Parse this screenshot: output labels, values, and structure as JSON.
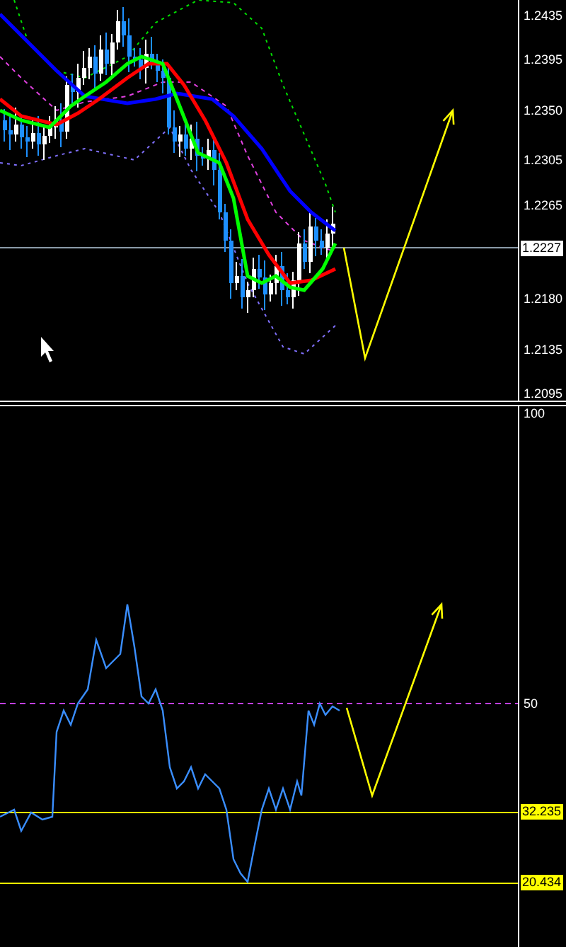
{
  "price_panel": {
    "axis_ticks": [
      "1.2435",
      "1.2395",
      "1.2350",
      "1.2305",
      "1.2265",
      "1.2180",
      "1.2135",
      "1.2095"
    ],
    "current_price": "1.2227"
  },
  "indicator_panel": {
    "axis_ticks": [
      "100",
      "50"
    ],
    "levels": [
      "32.235",
      "20.434"
    ]
  }
}
